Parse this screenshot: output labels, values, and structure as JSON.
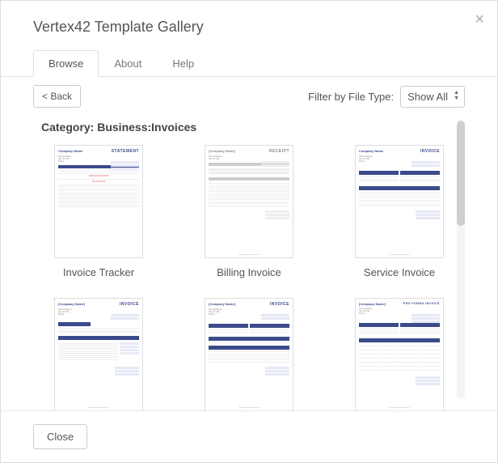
{
  "dialog": {
    "title": "Vertex42 Template Gallery",
    "close_x": "×"
  },
  "tabs": [
    {
      "label": "Browse",
      "active": true
    },
    {
      "label": "About",
      "active": false
    },
    {
      "label": "Help",
      "active": false
    }
  ],
  "toolbar": {
    "back_label": "< Back",
    "filter_label": "Filter by File Type:",
    "filter_value": "Show All"
  },
  "category": {
    "prefix": "Category: ",
    "path": "Business:Invoices"
  },
  "templates": [
    {
      "label": "Invoice Tracker",
      "doctype": "STATEMENT",
      "brand": "Company Name",
      "style": "statement"
    },
    {
      "label": "Billing Invoice",
      "doctype": "RECEIPT",
      "brand": "[Company Name]",
      "style": "receipt"
    },
    {
      "label": "Service Invoice",
      "doctype": "INVOICE",
      "brand": "Company Name",
      "style": "invoice-blue"
    },
    {
      "label": "",
      "doctype": "INVOICE",
      "brand": "[Company Name]",
      "style": "invoice-blue"
    },
    {
      "label": "",
      "doctype": "INVOICE",
      "brand": "[Company Name]",
      "style": "invoice-blue"
    },
    {
      "label": "",
      "doctype": "PRO FORMA INVOICE",
      "brand": "[Company Name]",
      "style": "proforma"
    }
  ],
  "footer": {
    "close_label": "Close"
  }
}
